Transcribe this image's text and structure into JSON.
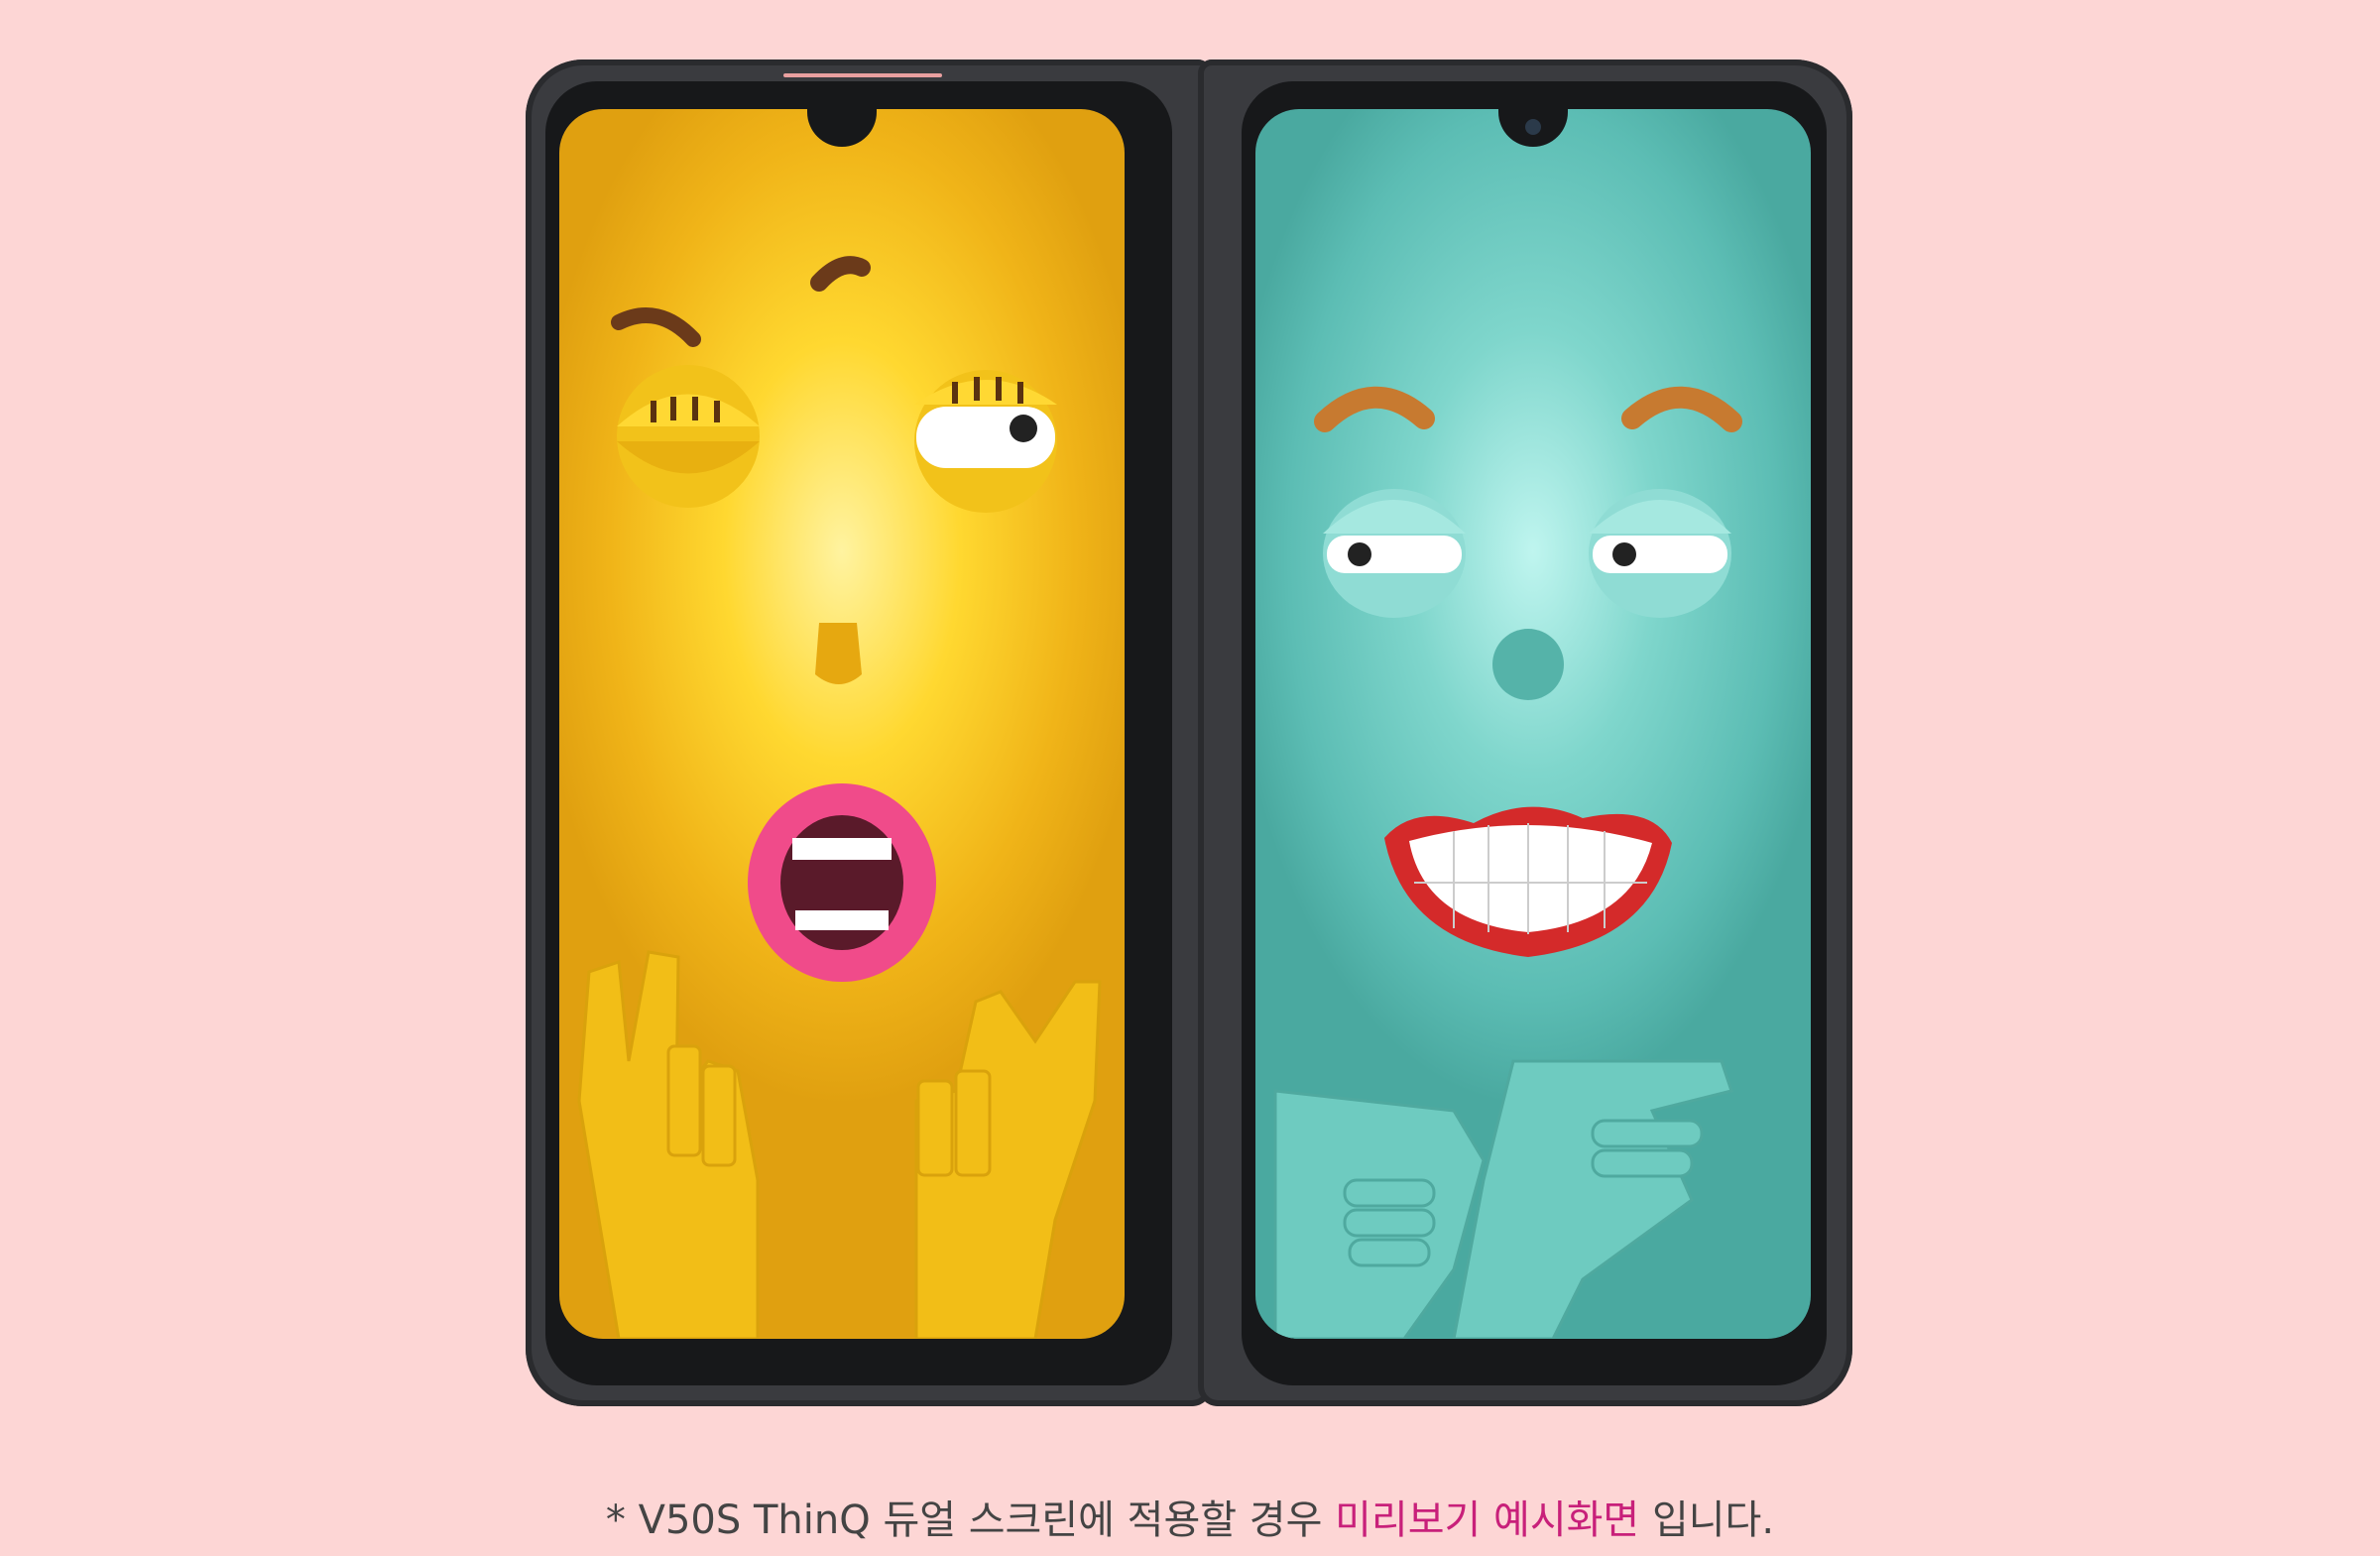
{
  "caption": {
    "prefix": "* V50S ThinQ 듀얼 스크린에 적용할 경우 ",
    "highlight": "미리보기 예시화면",
    "suffix": " 입니다."
  },
  "colors": {
    "background": "#fdd6d5",
    "highlight": "#c8207a",
    "left_screen": "#ffd830",
    "right_screen": "#7fd6cc"
  },
  "left_screen": {
    "theme": "yellow-emoji-face-with-finger-hearts"
  },
  "right_screen": {
    "theme": "teal-emoji-face-grinning-pointing"
  }
}
